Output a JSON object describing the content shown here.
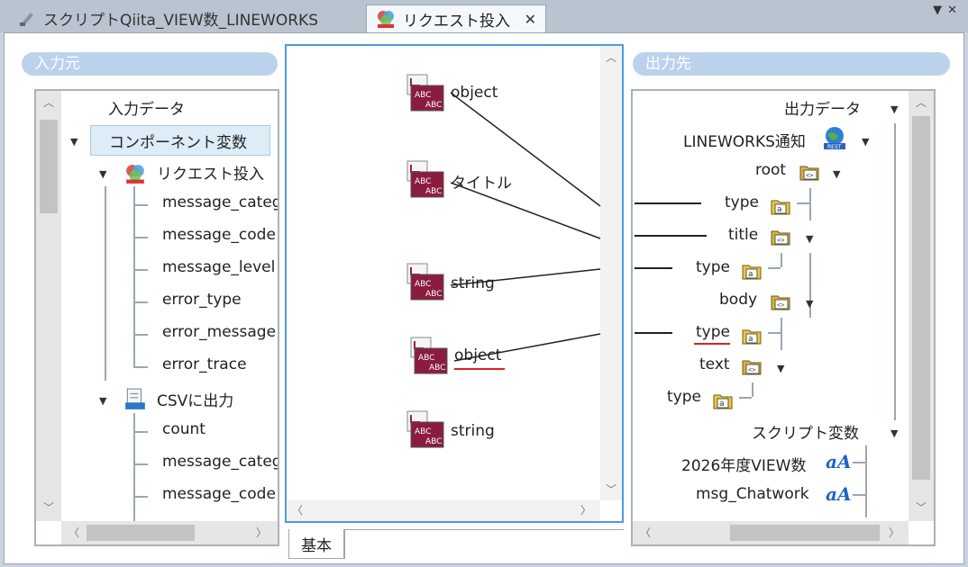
{
  "tabs": [
    {
      "label": "スクリプトQiita_VIEW数_LINEWORKS",
      "icon": "script-icon",
      "active": false
    },
    {
      "label": "リクエスト投入",
      "icon": "request-icon",
      "active": true
    }
  ],
  "left_panel": {
    "title": "入力元",
    "root": "入力データ",
    "group": "コンポーネント変数",
    "component1": "リクエスト投入",
    "component1_fields": [
      "message_category",
      "message_code",
      "message_level",
      "error_type",
      "error_message",
      "error_trace"
    ],
    "component2": "CSVに出力",
    "component2_fields": [
      "count",
      "message_category",
      "message_code"
    ]
  },
  "center": {
    "nodes": [
      "object",
      "タイトル",
      "string",
      "object",
      "string"
    ],
    "footer_tab": "基本"
  },
  "right_panel": {
    "title": "出力先",
    "root": "出力データ",
    "component": "LINEWORKS通知",
    "tree": [
      {
        "label": "root",
        "icon": "element-icon"
      },
      {
        "label": "type",
        "icon": "attribute-icon"
      },
      {
        "label": "title",
        "icon": "element-icon"
      },
      {
        "label": "type",
        "icon": "attribute-icon"
      },
      {
        "label": "body",
        "icon": "element-icon"
      },
      {
        "label": "type",
        "icon": "attribute-icon"
      },
      {
        "label": "text",
        "icon": "element-icon"
      },
      {
        "label": "type",
        "icon": "attribute-icon"
      }
    ],
    "script_vars_label": "スクリプト変数",
    "script_vars": [
      "2026年度VIEW数",
      "msg_Chatwork"
    ]
  },
  "colors": {
    "accent": "#4d9be0",
    "highlight": "#e02020",
    "pill": "#bcd2ec"
  }
}
